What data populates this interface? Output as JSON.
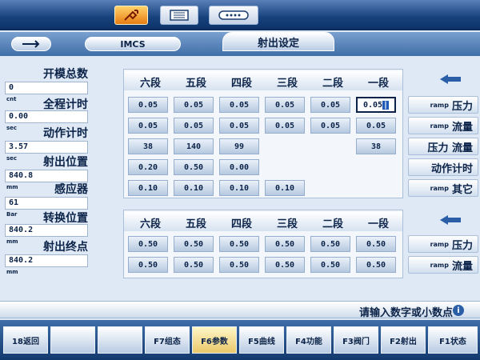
{
  "topbar": {
    "power_icon": "power-plug-icon",
    "screen_icon": "screen-icon",
    "keys_icon": "keyboard-icon"
  },
  "titlebar": {
    "back_icon": "hand-pointer-icon",
    "system_name": "IMCS",
    "page_title": "射出设定"
  },
  "left_panel": {
    "items": [
      {
        "label": "开模总数",
        "value": "0",
        "unit": "cnt"
      },
      {
        "label": "全程计时",
        "value": "0.00",
        "unit": "sec"
      },
      {
        "label": "动作计时",
        "value": "3.57",
        "unit": "sec"
      },
      {
        "label": "射出位置",
        "value": "840.8",
        "unit": "mm"
      },
      {
        "label": "感应器",
        "value": "61",
        "unit": "Bar"
      },
      {
        "label": "转换位置",
        "value": "840.2",
        "unit": "mm"
      },
      {
        "label": "射出终点",
        "value": "840.2",
        "unit": "mm"
      }
    ]
  },
  "table1": {
    "headers": [
      "一段",
      "二段",
      "三段",
      "四段",
      "五段",
      "六段"
    ],
    "rows": [
      [
        "0.05",
        "0.05",
        "0.05",
        "0.05",
        "0.05",
        "0.05"
      ],
      [
        "0.05",
        "0.05",
        "0.05",
        "0.05",
        "0.05",
        "0.05"
      ],
      [
        "",
        "",
        "99",
        "140",
        "38",
        "38"
      ],
      [
        "",
        "",
        "",
        "0.00",
        "0.50",
        "0.20"
      ],
      [
        "",
        "",
        "0.10",
        "0.10",
        "0.10",
        "0.10"
      ]
    ],
    "row_labels": [
      {
        "main": "压力",
        "sub": "ramp"
      },
      {
        "main": "流量",
        "sub": "ramp"
      },
      {
        "main": "压力 流量",
        "sub": ""
      },
      {
        "main": "动作计时",
        "sub": ""
      },
      {
        "main": "其它",
        "sub": "ramp"
      }
    ]
  },
  "table2": {
    "headers": [
      "一段",
      "二段",
      "三段",
      "四段",
      "五段",
      "六段"
    ],
    "rows": [
      [
        "0.50",
        "0.50",
        "0.50",
        "0.50",
        "0.50",
        "0.50"
      ],
      [
        "0.50",
        "0.50",
        "0.50",
        "0.50",
        "0.50",
        "0.50"
      ]
    ],
    "row_labels": [
      {
        "main": "压力",
        "sub": "ramp"
      },
      {
        "main": "流量",
        "sub": "ramp"
      }
    ]
  },
  "hint": {
    "text": "请输入数字或小数点",
    "icon": "info-icon"
  },
  "function_keys": [
    {
      "label": "18返回"
    },
    {
      "label": ""
    },
    {
      "label": ""
    },
    {
      "label": "F7组态"
    },
    {
      "label": "F6参数"
    },
    {
      "label": "F5曲线"
    },
    {
      "label": "F4功能"
    },
    {
      "label": "F3阀门"
    },
    {
      "label": "F2射出"
    },
    {
      "label": "F1状态"
    }
  ],
  "colors": {
    "topbar": "#16427c",
    "accent": "#e77c12",
    "text": "#0b2348",
    "selected_key": "#e9c86a"
  }
}
